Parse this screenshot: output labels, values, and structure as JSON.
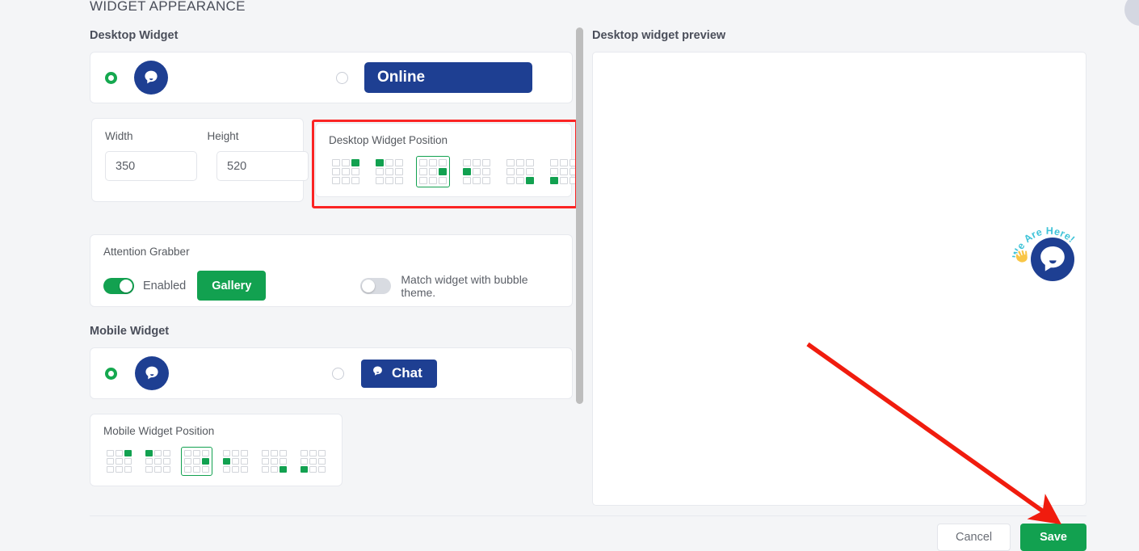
{
  "section": {
    "title": "WIDGET APPEARANCE"
  },
  "desktop": {
    "heading": "Desktop Widget",
    "style_options": [
      {
        "id": "bubble",
        "icon": "chat-bubble-icon",
        "selected": true
      },
      {
        "id": "label",
        "label": "Online",
        "selected": false
      }
    ],
    "size": {
      "width_label": "Width",
      "height_label": "Height",
      "width_value": "350",
      "height_value": "520",
      "width_placeholder": "Width",
      "height_placeholder": "Height"
    },
    "position": {
      "title": "Desktop Widget Position",
      "options": [
        {
          "name": "top-right",
          "cell": 2,
          "selected": false
        },
        {
          "name": "top-left",
          "cell": 0,
          "selected": false
        },
        {
          "name": "middle-right",
          "cell": 5,
          "selected": true
        },
        {
          "name": "middle-left",
          "cell": 3,
          "selected": false
        },
        {
          "name": "bottom-right",
          "cell": 8,
          "selected": false
        },
        {
          "name": "bottom-left",
          "cell": 6,
          "selected": false
        }
      ]
    }
  },
  "attention_grabber": {
    "title": "Attention Grabber",
    "enabled_label": "Enabled",
    "enabled": true,
    "gallery_label": "Gallery",
    "match_label": "Match widget with bubble theme.",
    "match_enabled": false
  },
  "mobile": {
    "heading": "Mobile Widget",
    "style_options": [
      {
        "id": "bubble",
        "icon": "chat-bubble-icon",
        "selected": true
      },
      {
        "id": "label",
        "label": "Chat",
        "selected": false
      }
    ],
    "position": {
      "title": "Mobile Widget Position",
      "options": [
        {
          "name": "top-right",
          "cell": 2,
          "selected": false
        },
        {
          "name": "top-left",
          "cell": 0,
          "selected": false
        },
        {
          "name": "middle-right",
          "cell": 5,
          "selected": true
        },
        {
          "name": "middle-left",
          "cell": 3,
          "selected": false
        },
        {
          "name": "bottom-right",
          "cell": 8,
          "selected": false
        },
        {
          "name": "bottom-left",
          "cell": 6,
          "selected": false
        }
      ]
    }
  },
  "preview": {
    "label": "Desktop widget preview",
    "grabber_text": "We Are Here!",
    "hand_icon": "waving-hand-icon"
  },
  "footer": {
    "cancel_label": "Cancel",
    "save_label": "Save"
  },
  "annotations": {
    "highlight_target": "desktop-widget-position",
    "arrow_target": "save-button"
  },
  "colors": {
    "brand_blue": "#1e3f92",
    "accent_green": "#12a150",
    "annotation_red": "#fb2424",
    "page_bg": "#f4f5f7"
  }
}
